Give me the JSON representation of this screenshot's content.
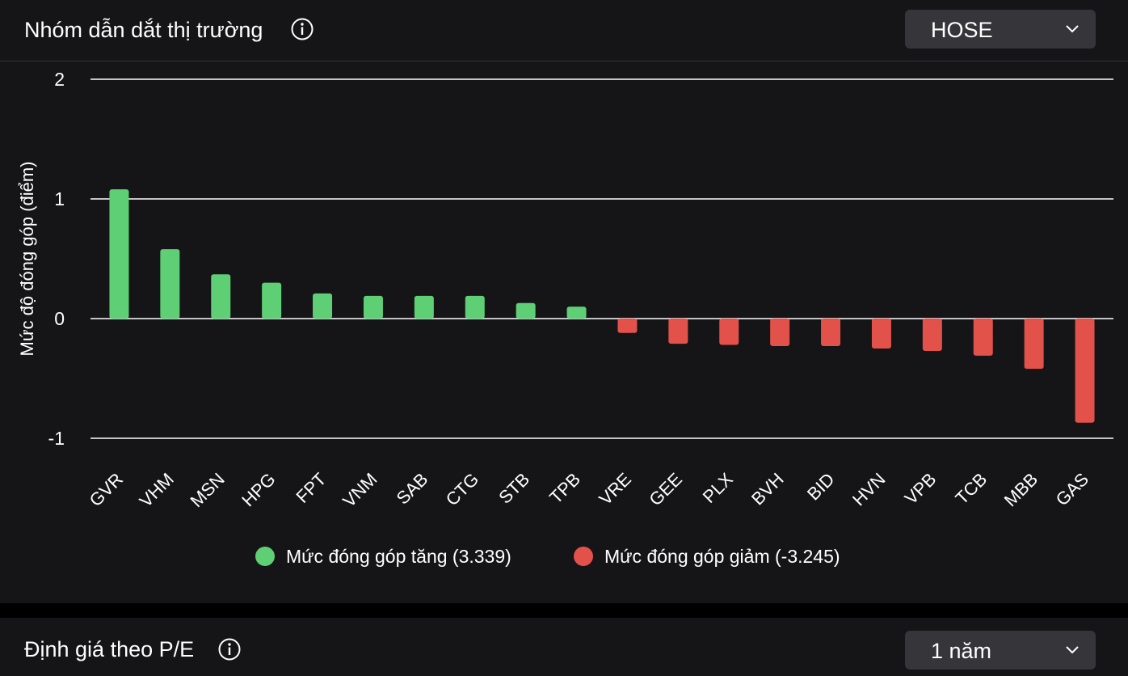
{
  "colors": {
    "positive": "#5ecf74",
    "negative": "#e2524b",
    "grid": "#ffffff",
    "panel_bg": "#151518",
    "select_bg": "#35353a"
  },
  "top_panel": {
    "title": "Nhóm dẫn dắt thị trường",
    "info_icon": "info-circle-icon",
    "exchange_select": {
      "value": "HOSE",
      "icon": "chevron-down-icon"
    }
  },
  "bottom_panel": {
    "title": "Định giá theo P/E",
    "info_icon": "info-circle-icon",
    "period_select": {
      "value": "1 năm",
      "icon": "chevron-down-icon"
    }
  },
  "chart_data": {
    "type": "bar",
    "title": "",
    "xlabel": "",
    "ylabel": "Mức độ đóng góp (điểm)",
    "ylim": [
      -1,
      2
    ],
    "yticks": [
      2,
      1,
      0,
      -1
    ],
    "grid": true,
    "legend_position": "bottom-center",
    "categories": [
      "GVR",
      "VHM",
      "MSN",
      "HPG",
      "FPT",
      "VNM",
      "SAB",
      "CTG",
      "STB",
      "TPB",
      "VRE",
      "GEE",
      "PLX",
      "BVH",
      "BID",
      "HVN",
      "VPB",
      "TCB",
      "MBB",
      "GAS"
    ],
    "values": [
      1.08,
      0.58,
      0.37,
      0.3,
      0.21,
      0.19,
      0.19,
      0.19,
      0.13,
      0.1,
      -0.12,
      -0.21,
      -0.22,
      -0.23,
      -0.23,
      -0.25,
      -0.27,
      -0.31,
      -0.42,
      -0.87
    ],
    "legend": [
      {
        "label": "Mức đóng góp tăng (3.339)",
        "color": "#5ecf74"
      },
      {
        "label": "Mức đóng góp giảm (-3.245)",
        "color": "#e2524b"
      }
    ]
  }
}
